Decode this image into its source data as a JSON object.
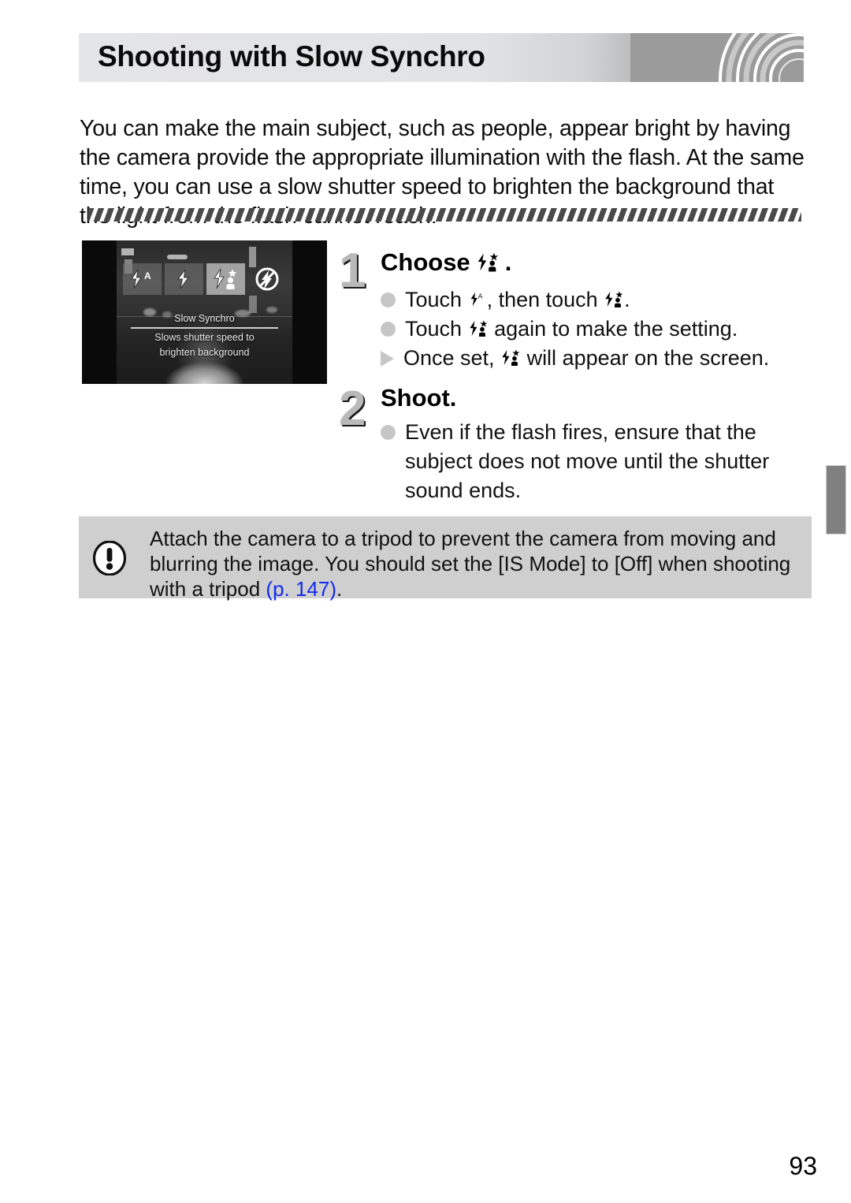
{
  "header": {
    "title": "Shooting with Slow Synchro",
    "decoration": "concentric-rings",
    "bg_left": "#e4e5e7",
    "bg_right": "#9b9b9b"
  },
  "intro": {
    "paragraph": "You can make the main subject, such as people, appear bright by having the camera provide the appropriate illumination with the flash. At the same time, you can use a slow shutter speed to brighten the background that the light from the flash cannot reach."
  },
  "divider": {
    "style": "diagonal-hatch"
  },
  "camera_screen": {
    "icons": [
      {
        "name": "flash-auto-icon",
        "label": "Flash Auto",
        "selected": false,
        "framed": true
      },
      {
        "name": "flash-on-icon",
        "label": "Flash On",
        "selected": false,
        "framed": true
      },
      {
        "name": "slow-synchro-icon",
        "label": "Slow Synchro",
        "selected": true,
        "framed": true
      },
      {
        "name": "flash-off-icon",
        "label": "Flash Off",
        "selected": false,
        "framed": false
      }
    ],
    "mode_label": "Slow Synchro",
    "description_line1": "Slows shutter speed to",
    "description_line2": "brighten background"
  },
  "steps": [
    {
      "number": "1",
      "heading_prefix": "Choose",
      "heading_icon": "slow-synchro-icon",
      "heading_suffix": ".",
      "bullets": [
        {
          "marker": "dot",
          "parts": [
            "Touch ",
            "flash-auto-icon",
            ", then touch ",
            "slow-synchro-icon",
            "."
          ]
        },
        {
          "marker": "dot",
          "parts": [
            "Touch ",
            "slow-synchro-icon",
            " again to make the setting."
          ]
        },
        {
          "marker": "triangle",
          "parts": [
            "Once set, ",
            "slow-synchro-icon",
            " will appear on the screen."
          ]
        }
      ]
    },
    {
      "number": "2",
      "heading_prefix": "Shoot.",
      "heading_icon": "",
      "heading_suffix": "",
      "bullets": [
        {
          "marker": "dot",
          "parts": [
            "Even if the flash fires, ensure that the subject does not move until the shutter sound ends."
          ]
        }
      ]
    }
  ],
  "step1": {
    "number": "1",
    "heading": "Choose",
    "heading_end": ".",
    "b1_a": "Touch ",
    "b1_b": ", then touch ",
    "b1_c": ".",
    "b2_a": "Touch ",
    "b2_b": " again to make the setting.",
    "b3_a": "Once set, ",
    "b3_b": " will appear on the screen."
  },
  "step2": {
    "number": "2",
    "heading": "Shoot.",
    "b1": "Even if the flash fires, ensure that the subject does not move until the shutter sound ends."
  },
  "note": {
    "icon": "exclamation-circle-icon",
    "text_a": "Attach the camera to a tripod to prevent the camera from moving and blurring the image. You should set the [IS Mode] to [Off] when shooting with a tripod ",
    "page_ref": "(p. 147)",
    "text_b": ".",
    "ref_color": "#1329f0",
    "bg_color": "#cfcfcf"
  },
  "side_tab": {
    "color": "#808080"
  },
  "page_number": "93"
}
